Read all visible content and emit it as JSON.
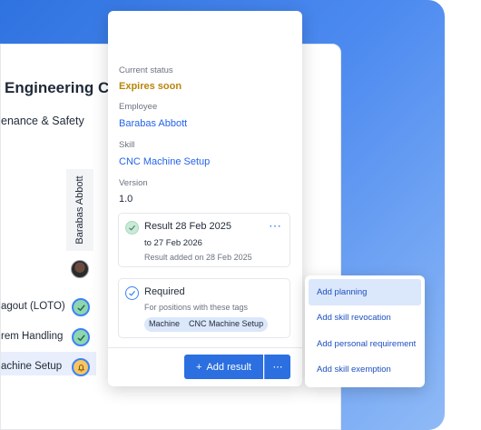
{
  "app": {
    "company": "Engineering Co.",
    "department": "enance & Safety",
    "employee_column": "Barabas Abbott",
    "rows": [
      {
        "label": "agout (LOTO)",
        "status": "valid"
      },
      {
        "label": "rem Handling",
        "status": "valid"
      },
      {
        "label": "achine Setup",
        "status": "expiring"
      }
    ]
  },
  "popover": {
    "status_label": "Current status",
    "status_value": "Expires soon",
    "employee_label": "Employee",
    "employee_value": "Barabas Abbott",
    "skill_label": "Skill",
    "skill_value": "CNC Machine Setup",
    "version_label": "Version",
    "version_value": "1.0",
    "result": {
      "title": "Result 28 Feb 2025",
      "to": "to 27 Feb 2026",
      "added": "Result added on 28 Feb 2025",
      "more": "⋯"
    },
    "required": {
      "title": "Required",
      "subtitle": "For positions with these tags",
      "tags": [
        "Machine",
        "CNC Machine Setup"
      ]
    },
    "add_result_label": "Add result",
    "add_icon": "+",
    "more_button": "⋯"
  },
  "menu": {
    "items": [
      {
        "label": "Add planning",
        "active": true
      },
      {
        "label": "Add skill revocation",
        "active": false
      },
      {
        "label": "Add personal requirement",
        "active": false
      },
      {
        "label": "Add skill exemption",
        "active": false
      }
    ]
  },
  "colors": {
    "accent": "#2b6fe0",
    "expires_soon": "#b8860b",
    "valid": "#8fd6b0",
    "expiring": "#f7c661"
  }
}
